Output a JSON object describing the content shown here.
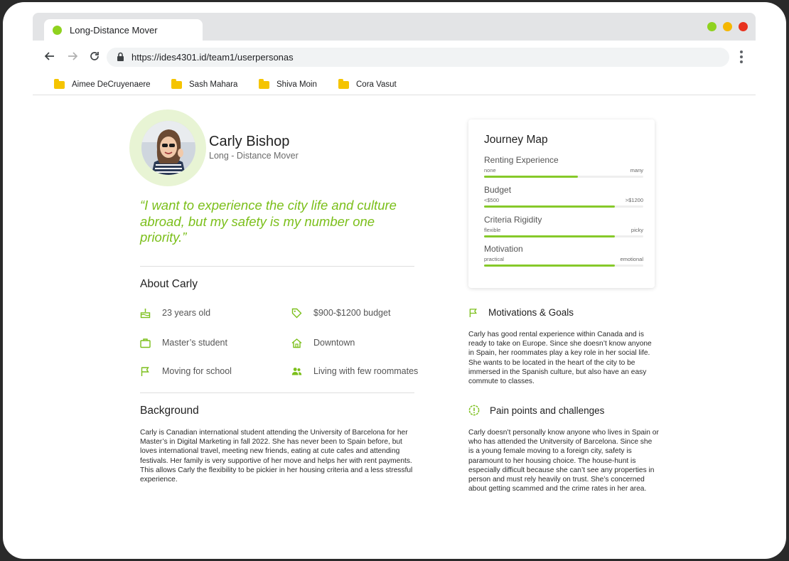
{
  "browser": {
    "tab_title": "Long-Distance Mover",
    "url": "https://ides4301.id/team1/userpersonas",
    "window_controls": {
      "green": "#8fd21f",
      "yellow": "#f5b700",
      "red": "#e8321e"
    },
    "bookmarks": [
      "Aimee DeCruyenaere",
      "Sash Mahara",
      "Shiva Moin",
      "Cora Vasut"
    ]
  },
  "persona": {
    "name": "Carly Bishop",
    "role": "Long - Distance Mover",
    "quote": "“I want to experience the city life and culture abroad, but my safety is my number one priority.”"
  },
  "about": {
    "heading": "About Carly",
    "facts": [
      {
        "icon": "cake-icon",
        "label": "23 years old"
      },
      {
        "icon": "tag-icon",
        "label": "$900-$1200 budget"
      },
      {
        "icon": "briefcase-icon",
        "label": "Master’s student"
      },
      {
        "icon": "home-icon",
        "label": "Downtown"
      },
      {
        "icon": "flag-icon",
        "label": "Moving for school"
      },
      {
        "icon": "people-icon",
        "label": "Living with few roommates"
      }
    ]
  },
  "background": {
    "heading": "Background",
    "text": "Carly is Canadian international student attending the University of Barcelona for her Master’s in Digital Marketing in fall 2022. She has never been to Spain before, but loves international travel, meeting new friends, eating at cute cafes and attending festivals. Her family is very supportive of her move and helps her with rent payments. This allows Carly the flexibility to be pickier in her housing criteria and a less stressful experience."
  },
  "journey_map": {
    "title": "Journey Map",
    "items": [
      {
        "label": "Renting Experience",
        "low": "none",
        "high": "many",
        "value": 0.59
      },
      {
        "label": "Budget",
        "low": "<$500",
        "high": ">$1200",
        "value": 0.82
      },
      {
        "label": "Criteria Rigidity",
        "low": "flexible",
        "high": "picky",
        "value": 0.82
      },
      {
        "label": "Motivation",
        "low": "practical",
        "high": "emotional",
        "value": 0.82
      }
    ]
  },
  "motivations": {
    "heading": "Motivations & Goals",
    "text": "Carly has good rental experience within Canada and is ready to take on Europe. Since she doesn’t know anyone in Spain, her roommates play a key role in her social life. She wants to be located in the heart of the city to be immersed in the Spanish culture, but also have an easy commute to classes."
  },
  "pain_points": {
    "heading": "Pain points and challenges",
    "text": "Carly doesn’t personally know anyone who lives in Spain or who has attended the Unitversity of Barcelona. Since she is a young female moving to a foreign city, safety is paramount to her housing choice. The house-hunt is especially difficult because she can’t see any properties in person and must rely heavily on trust. She’s concerned about getting scammed and the crime rates in her area."
  },
  "accent_color": "#7bbf1a"
}
